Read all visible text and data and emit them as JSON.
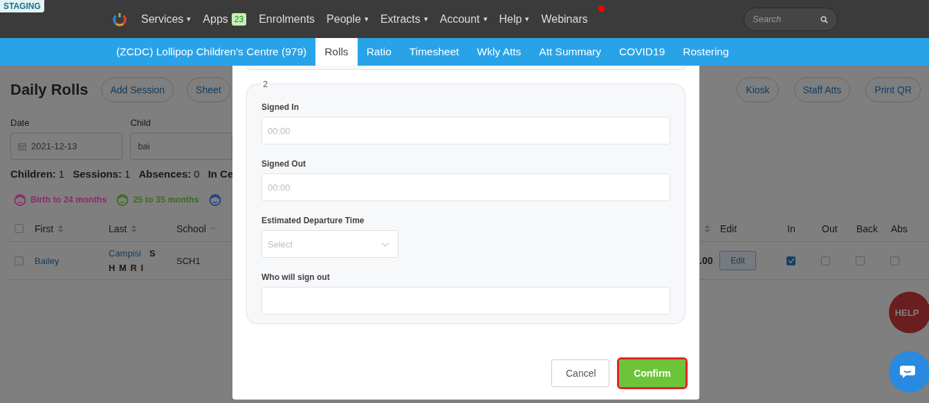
{
  "environment_badge": "STAGING",
  "nav": {
    "items": [
      {
        "label": "Services",
        "caret": "▾",
        "notification": false
      },
      {
        "label": "Apps",
        "badge": "23",
        "notification": false
      },
      {
        "label": "Enrolments",
        "notification": false
      },
      {
        "label": "People",
        "caret": "▾",
        "notification": false
      },
      {
        "label": "Extracts",
        "caret": "▾",
        "notification": false
      },
      {
        "label": "Account",
        "caret": "▾",
        "notification": false
      },
      {
        "label": "Help",
        "caret": "▾",
        "notification": false
      },
      {
        "label": "Webinars",
        "notification": true
      }
    ],
    "search": {
      "placeholder": "Search"
    }
  },
  "subnav": {
    "items": [
      {
        "label": "(ZCDC) Lollipop Children's Centre (979)",
        "selected": false
      },
      {
        "label": "Rolls",
        "selected": true
      },
      {
        "label": "Ratio",
        "selected": false
      },
      {
        "label": "Timesheet",
        "selected": false
      },
      {
        "label": "Wkly Atts",
        "selected": false
      },
      {
        "label": "Att Summary",
        "selected": false
      },
      {
        "label": "COVID19",
        "selected": false
      },
      {
        "label": "Rostering",
        "selected": false
      }
    ]
  },
  "page": {
    "title": "Daily Rolls",
    "left_buttons": [
      "Add Session",
      "Sheet"
    ],
    "right_buttons": [
      "Kiosk",
      "Staff Atts",
      "Print QR"
    ],
    "filters": [
      {
        "label": "Date",
        "value": "2021-12-13",
        "kind": "date"
      },
      {
        "label": "Child",
        "value": "bai",
        "kind": "text"
      }
    ],
    "stats": [
      {
        "label": "Children:",
        "value": "1"
      },
      {
        "label": "Sessions:",
        "value": "1"
      },
      {
        "label": "Absences:",
        "value": "0"
      },
      {
        "label": "In Ce"
      }
    ],
    "age_groups": [
      {
        "label": "Birth to 24 months",
        "color": "#8c2a6c"
      },
      {
        "label": "25 to 35 months",
        "color": "#3a6e1c"
      },
      {
        "color": "#1e3f8c"
      }
    ],
    "table": {
      "select_all_checked": false,
      "columns_left": [
        {
          "label": "First",
          "kind": "sort"
        },
        {
          "label": "Last",
          "kind": "sort"
        },
        {
          "label": "School",
          "kind": "filter"
        }
      ],
      "columns_right": [
        "Edit",
        "In",
        "Out",
        "Back",
        "Abs"
      ],
      "rows": [
        {
          "selected": false,
          "first": "Bailey",
          "last": "Campisi",
          "flag": "S",
          "codes": "H M R I",
          "school": "SCH1",
          "partial_value": ".00",
          "edit": "Edit",
          "in": true,
          "out": false,
          "back": false,
          "abs": false
        }
      ]
    }
  },
  "modal": {
    "section_legend": "2",
    "fields": [
      {
        "label": "Signed In",
        "placeholder": "00:00",
        "kind": "input"
      },
      {
        "label": "Signed Out",
        "placeholder": "00:00",
        "kind": "input"
      },
      {
        "label": "Estimated Departure Time",
        "placeholder": "Select",
        "kind": "select"
      },
      {
        "label": "Who will sign out",
        "kind": "input"
      }
    ],
    "buttons": [
      {
        "label": "Cancel",
        "kind": "secondary",
        "highlighted": false
      },
      {
        "label": "Confirm",
        "kind": "primary",
        "highlighted": true
      }
    ]
  },
  "help_button": "HELP"
}
